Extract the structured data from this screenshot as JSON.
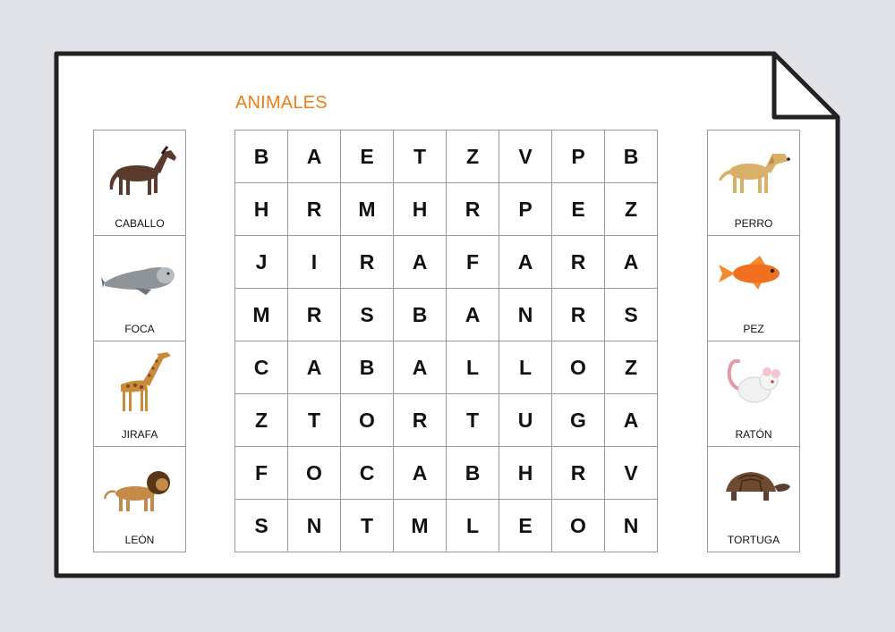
{
  "title": "ANIMALES",
  "colors": {
    "accent": "#f07d14",
    "background": "#e1e2e7",
    "sheet_border": "#222222",
    "grid_line": "#9a9a9a"
  },
  "left_cards": [
    {
      "label": "CABALLO",
      "icon": "horse-icon"
    },
    {
      "label": "FOCA",
      "icon": "seal-icon"
    },
    {
      "label": "JIRAFA",
      "icon": "giraffe-icon"
    },
    {
      "label": "LEÓN",
      "icon": "lion-icon"
    }
  ],
  "right_cards": [
    {
      "label": "PERRO",
      "icon": "dog-icon"
    },
    {
      "label": "PEZ",
      "icon": "fish-icon"
    },
    {
      "label": "RATÓN",
      "icon": "mouse-icon"
    },
    {
      "label": "TORTUGA",
      "icon": "tortoise-icon"
    }
  ],
  "grid": [
    [
      "B",
      "A",
      "E",
      "T",
      "Z",
      "V",
      "P",
      "B"
    ],
    [
      "H",
      "R",
      "M",
      "H",
      "R",
      "P",
      "E",
      "Z"
    ],
    [
      "J",
      "I",
      "R",
      "A",
      "F",
      "A",
      "R",
      "A"
    ],
    [
      "M",
      "R",
      "S",
      "B",
      "A",
      "N",
      "R",
      "S"
    ],
    [
      "C",
      "A",
      "B",
      "A",
      "L",
      "L",
      "O",
      "Z"
    ],
    [
      "Z",
      "T",
      "O",
      "R",
      "T",
      "U",
      "G",
      "A"
    ],
    [
      "F",
      "O",
      "C",
      "A",
      "B",
      "H",
      "R",
      "V"
    ],
    [
      "S",
      "N",
      "T",
      "M",
      "L",
      "E",
      "O",
      "N"
    ]
  ]
}
